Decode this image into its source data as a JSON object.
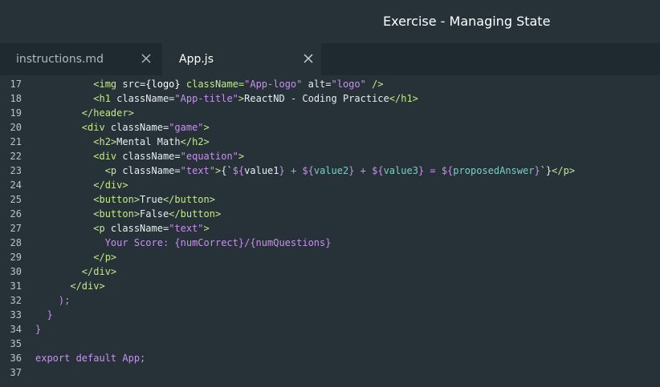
{
  "window": {
    "title": "Exercise - Managing State"
  },
  "tabs": [
    {
      "label": "instructions.md",
      "active": false,
      "close_icon": "close-icon"
    },
    {
      "label": "App.js",
      "active": true,
      "close_icon": "close-icon"
    }
  ],
  "colors": {
    "background": "#263238",
    "tabbar": "#1f2a30",
    "tag": "#c3e88d",
    "attr": "#c792ea",
    "line_number": "#b7c4cb"
  },
  "code": {
    "lines": [
      {
        "n": "17",
        "tokens": [
          {
            "t": "          ",
            "c": "txt"
          },
          {
            "t": "<img",
            "c": "tag"
          },
          {
            "t": " src=",
            "c": "txt"
          },
          {
            "t": "{logo}",
            "c": "ref"
          },
          {
            "t": " className=",
            "c": "tag"
          },
          {
            "t": "\"App-logo\"",
            "c": "str"
          },
          {
            "t": " alt=",
            "c": "txt"
          },
          {
            "t": "\"logo\"",
            "c": "str"
          },
          {
            "t": " />",
            "c": "tag"
          }
        ]
      },
      {
        "n": "18",
        "tokens": [
          {
            "t": "          ",
            "c": "txt"
          },
          {
            "t": "<h1",
            "c": "tag"
          },
          {
            "t": " className=",
            "c": "txt"
          },
          {
            "t": "\"App-title\"",
            "c": "str"
          },
          {
            "t": ">",
            "c": "tag"
          },
          {
            "t": "ReactND - Coding Practice",
            "c": "txt"
          },
          {
            "t": "</h1>",
            "c": "tag"
          }
        ]
      },
      {
        "n": "19",
        "tokens": [
          {
            "t": "        ",
            "c": "txt"
          },
          {
            "t": "</header>",
            "c": "tag"
          }
        ]
      },
      {
        "n": "20",
        "tokens": [
          {
            "t": "        ",
            "c": "txt"
          },
          {
            "t": "<div",
            "c": "tag"
          },
          {
            "t": " className=",
            "c": "txt"
          },
          {
            "t": "\"game\"",
            "c": "str"
          },
          {
            "t": ">",
            "c": "tag"
          }
        ]
      },
      {
        "n": "21",
        "tokens": [
          {
            "t": "          ",
            "c": "txt"
          },
          {
            "t": "<h2>",
            "c": "tag"
          },
          {
            "t": "Mental Math",
            "c": "txt"
          },
          {
            "t": "</h2>",
            "c": "tag"
          }
        ]
      },
      {
        "n": "22",
        "tokens": [
          {
            "t": "          ",
            "c": "txt"
          },
          {
            "t": "<div",
            "c": "tag"
          },
          {
            "t": " className=",
            "c": "txt"
          },
          {
            "t": "\"equation\"",
            "c": "str"
          },
          {
            "t": ">",
            "c": "tag"
          }
        ]
      },
      {
        "n": "23",
        "tokens": [
          {
            "t": "            ",
            "c": "txt"
          },
          {
            "t": "<p",
            "c": "tag"
          },
          {
            "t": " className=",
            "c": "txt"
          },
          {
            "t": "\"text\"",
            "c": "str"
          },
          {
            "t": ">",
            "c": "tag"
          },
          {
            "t": "{`",
            "c": "txt"
          },
          {
            "t": "${",
            "c": "kw"
          },
          {
            "t": "value1",
            "c": "txt"
          },
          {
            "t": "} + ${",
            "c": "kw"
          },
          {
            "t": "value2",
            "c": "var"
          },
          {
            "t": "} + ${",
            "c": "kw"
          },
          {
            "t": "value3",
            "c": "var"
          },
          {
            "t": "} = ${",
            "c": "kw"
          },
          {
            "t": "proposedAnswer",
            "c": "var"
          },
          {
            "t": "}",
            "c": "kw"
          },
          {
            "t": "`}",
            "c": "txt"
          },
          {
            "t": "</p>",
            "c": "tag"
          }
        ]
      },
      {
        "n": "24",
        "tokens": [
          {
            "t": "          ",
            "c": "txt"
          },
          {
            "t": "</div>",
            "c": "tag"
          }
        ]
      },
      {
        "n": "25",
        "tokens": [
          {
            "t": "          ",
            "c": "txt"
          },
          {
            "t": "<button>",
            "c": "tag"
          },
          {
            "t": "True",
            "c": "txt"
          },
          {
            "t": "</button>",
            "c": "tag"
          }
        ]
      },
      {
        "n": "26",
        "tokens": [
          {
            "t": "          ",
            "c": "txt"
          },
          {
            "t": "<button>",
            "c": "tag"
          },
          {
            "t": "False",
            "c": "txt"
          },
          {
            "t": "</button>",
            "c": "tag"
          }
        ]
      },
      {
        "n": "27",
        "tokens": [
          {
            "t": "          ",
            "c": "txt"
          },
          {
            "t": "<p",
            "c": "tag"
          },
          {
            "t": " className=",
            "c": "txt"
          },
          {
            "t": "\"text\"",
            "c": "str"
          },
          {
            "t": ">",
            "c": "tag"
          }
        ]
      },
      {
        "n": "28",
        "tokens": [
          {
            "t": "            ",
            "c": "txt"
          },
          {
            "t": "Your Score: {numCorrect}/{numQuestions}",
            "c": "str"
          }
        ]
      },
      {
        "n": "29",
        "tokens": [
          {
            "t": "          ",
            "c": "txt"
          },
          {
            "t": "</p>",
            "c": "tag"
          }
        ]
      },
      {
        "n": "30",
        "tokens": [
          {
            "t": "        ",
            "c": "txt"
          },
          {
            "t": "</div>",
            "c": "tag"
          }
        ]
      },
      {
        "n": "31",
        "tokens": [
          {
            "t": "      ",
            "c": "txt"
          },
          {
            "t": "</div>",
            "c": "tag"
          }
        ]
      },
      {
        "n": "32",
        "tokens": [
          {
            "t": "    );",
            "c": "attr"
          }
        ]
      },
      {
        "n": "33",
        "tokens": [
          {
            "t": "  }",
            "c": "attr"
          }
        ]
      },
      {
        "n": "34",
        "tokens": [
          {
            "t": "}",
            "c": "attr"
          }
        ]
      },
      {
        "n": "35",
        "tokens": []
      },
      {
        "n": "36",
        "tokens": [
          {
            "t": "export default App;",
            "c": "attr"
          }
        ]
      },
      {
        "n": "37",
        "tokens": []
      }
    ]
  }
}
